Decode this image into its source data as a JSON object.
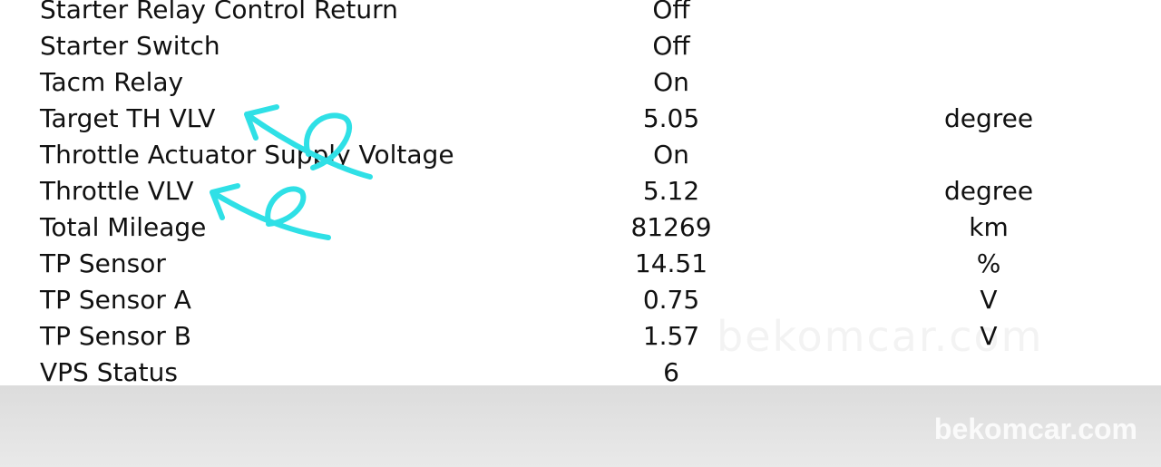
{
  "rows": [
    {
      "name": "Starter Relay Control Return",
      "value": "Off",
      "unit": ""
    },
    {
      "name": "Starter Switch",
      "value": "Off",
      "unit": ""
    },
    {
      "name": "Tacm Relay",
      "value": "On",
      "unit": ""
    },
    {
      "name": "Target TH VLV",
      "value": "5.05",
      "unit": "degree"
    },
    {
      "name": "Throttle Actuator Supply Voltage",
      "value": "On",
      "unit": ""
    },
    {
      "name": "Throttle VLV",
      "value": "5.12",
      "unit": "degree"
    },
    {
      "name": "Total Mileage",
      "value": "81269",
      "unit": "km"
    },
    {
      "name": "TP Sensor",
      "value": "14.51",
      "unit": "%"
    },
    {
      "name": "TP Sensor A",
      "value": "0.75",
      "unit": "V"
    },
    {
      "name": "TP Sensor B",
      "value": "1.57",
      "unit": "V"
    },
    {
      "name": "VPS Status",
      "value": "6",
      "unit": ""
    }
  ],
  "watermark": "bekomcar.com",
  "footer": {
    "brand": "bekomcar.com"
  },
  "colors": {
    "annotation": "#2fe0e6",
    "footer": "#e0e0e0"
  }
}
